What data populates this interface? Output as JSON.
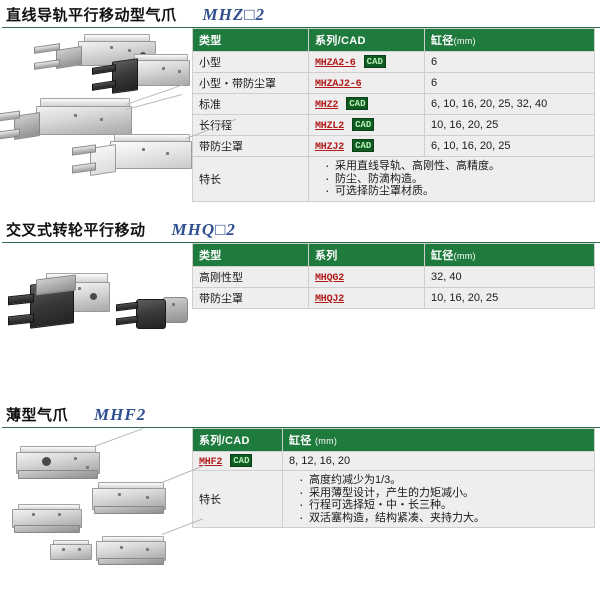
{
  "page": {
    "accent_green": "#1f7b3d",
    "badge_green": "#0f5c22",
    "link_red": "#b11b1b",
    "code_blue": "#2f4f8f",
    "table_bg": "#eeeeee"
  },
  "sections": [
    {
      "title_cn": "直线导轨平行移动型气爪",
      "title_code": "MHZ□2",
      "table": {
        "headers": [
          "类型",
          "系列/CAD",
          "缸径",
          "(mm)"
        ],
        "header_type": "类型",
        "header_series": "系列/CAD",
        "header_bore": "缸径",
        "header_bore_unit": "(mm)",
        "rows": [
          {
            "type": "小型",
            "series": "MHZA2-6",
            "cad": true,
            "bore": "6"
          },
          {
            "type": "小型・带防尘罩",
            "series": "MHZAJ2-6",
            "cad": false,
            "bore": "6"
          },
          {
            "type": "标准",
            "series": "MHZ2",
            "cad": true,
            "bore": "6, 10, 16, 20, 25, 32, 40"
          },
          {
            "type": "长行程",
            "series": "MHZL2",
            "cad": true,
            "bore": "10, 16, 20, 25"
          },
          {
            "type": "带防尘罩",
            "series": "MHZJ2",
            "cad": true,
            "bore": "6, 10, 16, 20, 25"
          }
        ],
        "features_label": "特长",
        "features": [
          "采用直线导轨、高刚性、高精度。",
          "防尘、防滴构造。",
          "可选择防尘罩材质。"
        ]
      },
      "photo_alt": "直线导轨平行移动型气爪产品照片"
    },
    {
      "title_cn": "交叉式转轮平行移动",
      "title_code": "MHQ□2",
      "table": {
        "header_type": "类型",
        "header_series": "系列",
        "header_bore": "缸径",
        "header_bore_unit": "(mm)",
        "rows": [
          {
            "type": "高刚性型",
            "series": "MHQG2",
            "cad": false,
            "bore": "32, 40"
          },
          {
            "type": "带防尘罩",
            "series": "MHQJ2",
            "cad": false,
            "bore": "10, 16, 20, 25"
          }
        ]
      },
      "photo_alt": "交叉式转轮平行移动气爪产品照片"
    },
    {
      "title_cn": "薄型气爪",
      "title_code": "MHF2",
      "table": {
        "header_series": "系列/CAD",
        "header_bore": "缸径",
        "header_bore_unit": "(mm)",
        "rows": [
          {
            "series": "MHF2",
            "cad": true,
            "bore": "8, 12, 16, 20"
          }
        ],
        "features_label": "特长",
        "features": [
          "高度约减少为1/3。",
          "采用薄型设计，产生的力矩减小。",
          "行程可选择短・中・长三种。",
          "双活塞构造，结构紧凑、夹持力大。"
        ]
      },
      "photo_alt": "薄型气爪产品照片"
    }
  ],
  "cad_badge_label": "CAD"
}
